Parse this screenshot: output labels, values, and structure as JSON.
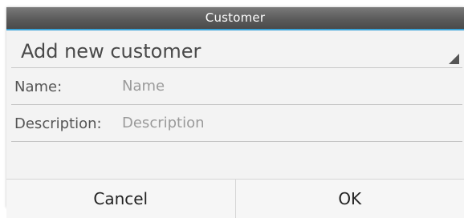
{
  "dialog": {
    "title": "Customer",
    "accent_color": "#3aa3d8"
  },
  "customer_select": {
    "selected": "Add new customer"
  },
  "fields": {
    "name": {
      "label": "Name:",
      "placeholder": "Name",
      "value": ""
    },
    "description": {
      "label": "Description:",
      "placeholder": "Description",
      "value": ""
    }
  },
  "buttons": {
    "cancel": "Cancel",
    "ok": "OK"
  }
}
